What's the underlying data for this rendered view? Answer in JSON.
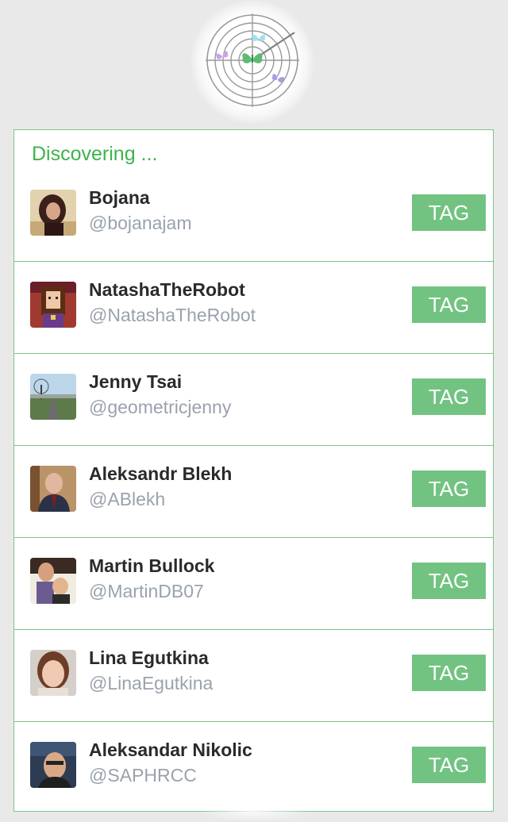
{
  "header": {
    "status_label": "Discovering ..."
  },
  "colors": {
    "accent": "#3cb44a",
    "button": "#72c382",
    "border": "#7cc58a",
    "handle": "#9aa2ad",
    "name": "#2a2a2a"
  },
  "people": [
    {
      "name": "Bojana",
      "handle": "@bojanajam",
      "action_label": "TAG"
    },
    {
      "name": "NatashaTheRobot",
      "handle": "@NatashaTheRobot",
      "action_label": "TAG"
    },
    {
      "name": "Jenny Tsai",
      "handle": "@geometricjenny",
      "action_label": "TAG"
    },
    {
      "name": "Aleksandr Blekh",
      "handle": "@ABlekh",
      "action_label": "TAG"
    },
    {
      "name": "Martin Bullock",
      "handle": "@MartinDB07",
      "action_label": "TAG"
    },
    {
      "name": "Lina Egutkina",
      "handle": "@LinaEgutkina",
      "action_label": "TAG"
    },
    {
      "name": "Aleksandar Nikolic",
      "handle": "@SAPHRCC",
      "action_label": "TAG"
    }
  ]
}
